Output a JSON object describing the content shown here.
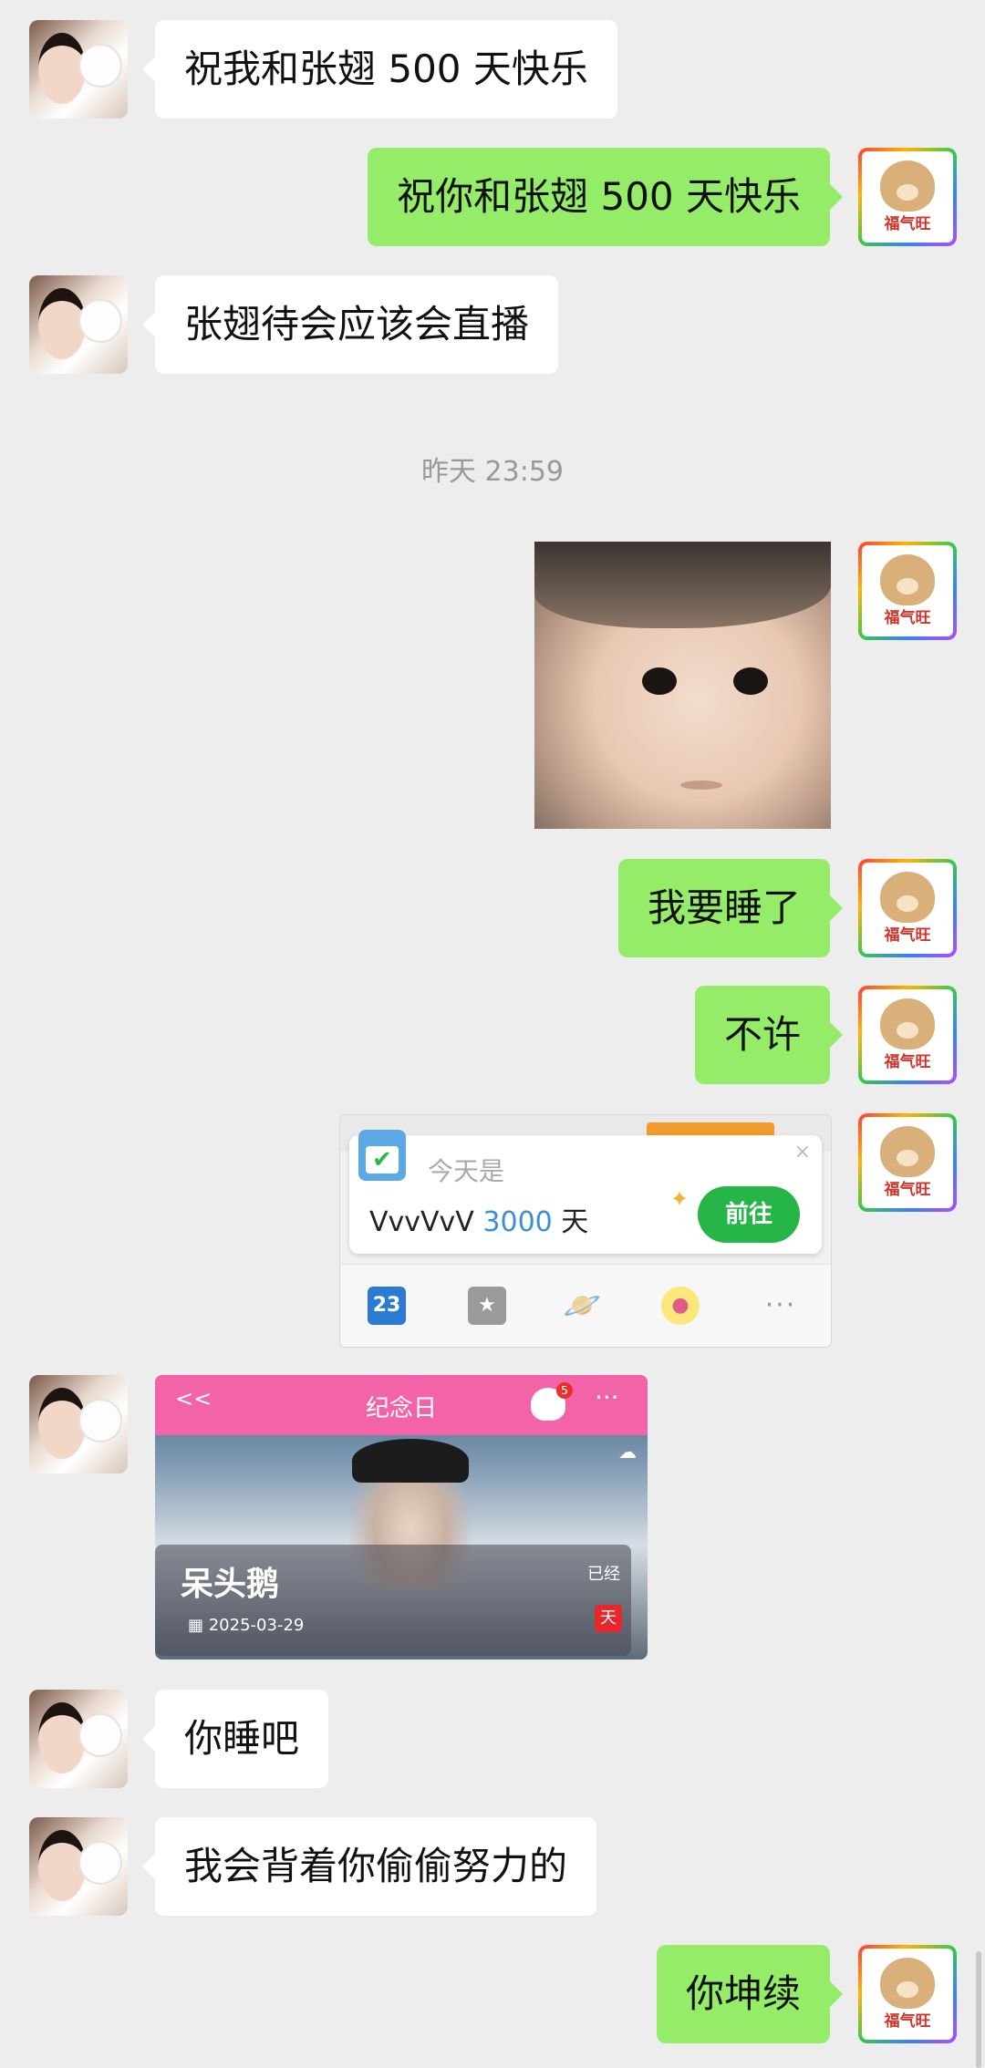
{
  "messages": [
    {
      "side": "left",
      "text": "祝我和张翅 500 天快乐"
    },
    {
      "side": "right",
      "text": "祝你和张翅 500 天快乐"
    },
    {
      "side": "left",
      "text": "张翅待会应该会直播"
    },
    {
      "side": "right",
      "text": "我要睡了"
    },
    {
      "side": "right",
      "text": "不许"
    },
    {
      "side": "left",
      "text": "你睡吧"
    },
    {
      "side": "left",
      "text": "我会背着你偷偷努力的"
    },
    {
      "side": "right",
      "text": "你坤续"
    }
  ],
  "timestamp": "昨天 23:59",
  "my_avatar_label": "福气旺",
  "screenshot_card": {
    "today_label": "今天是",
    "user": "VvvVvV",
    "days": "3000",
    "day_unit": "天",
    "go_button": "前往",
    "close": "×",
    "tab_calendar": "23"
  },
  "anniversary_card": {
    "back": "<<",
    "title": "纪念日",
    "badge": "5",
    "more": "···",
    "name": "呆头鹅",
    "date": "2025-03-29",
    "passed_label": "已经",
    "day_label": "天"
  }
}
